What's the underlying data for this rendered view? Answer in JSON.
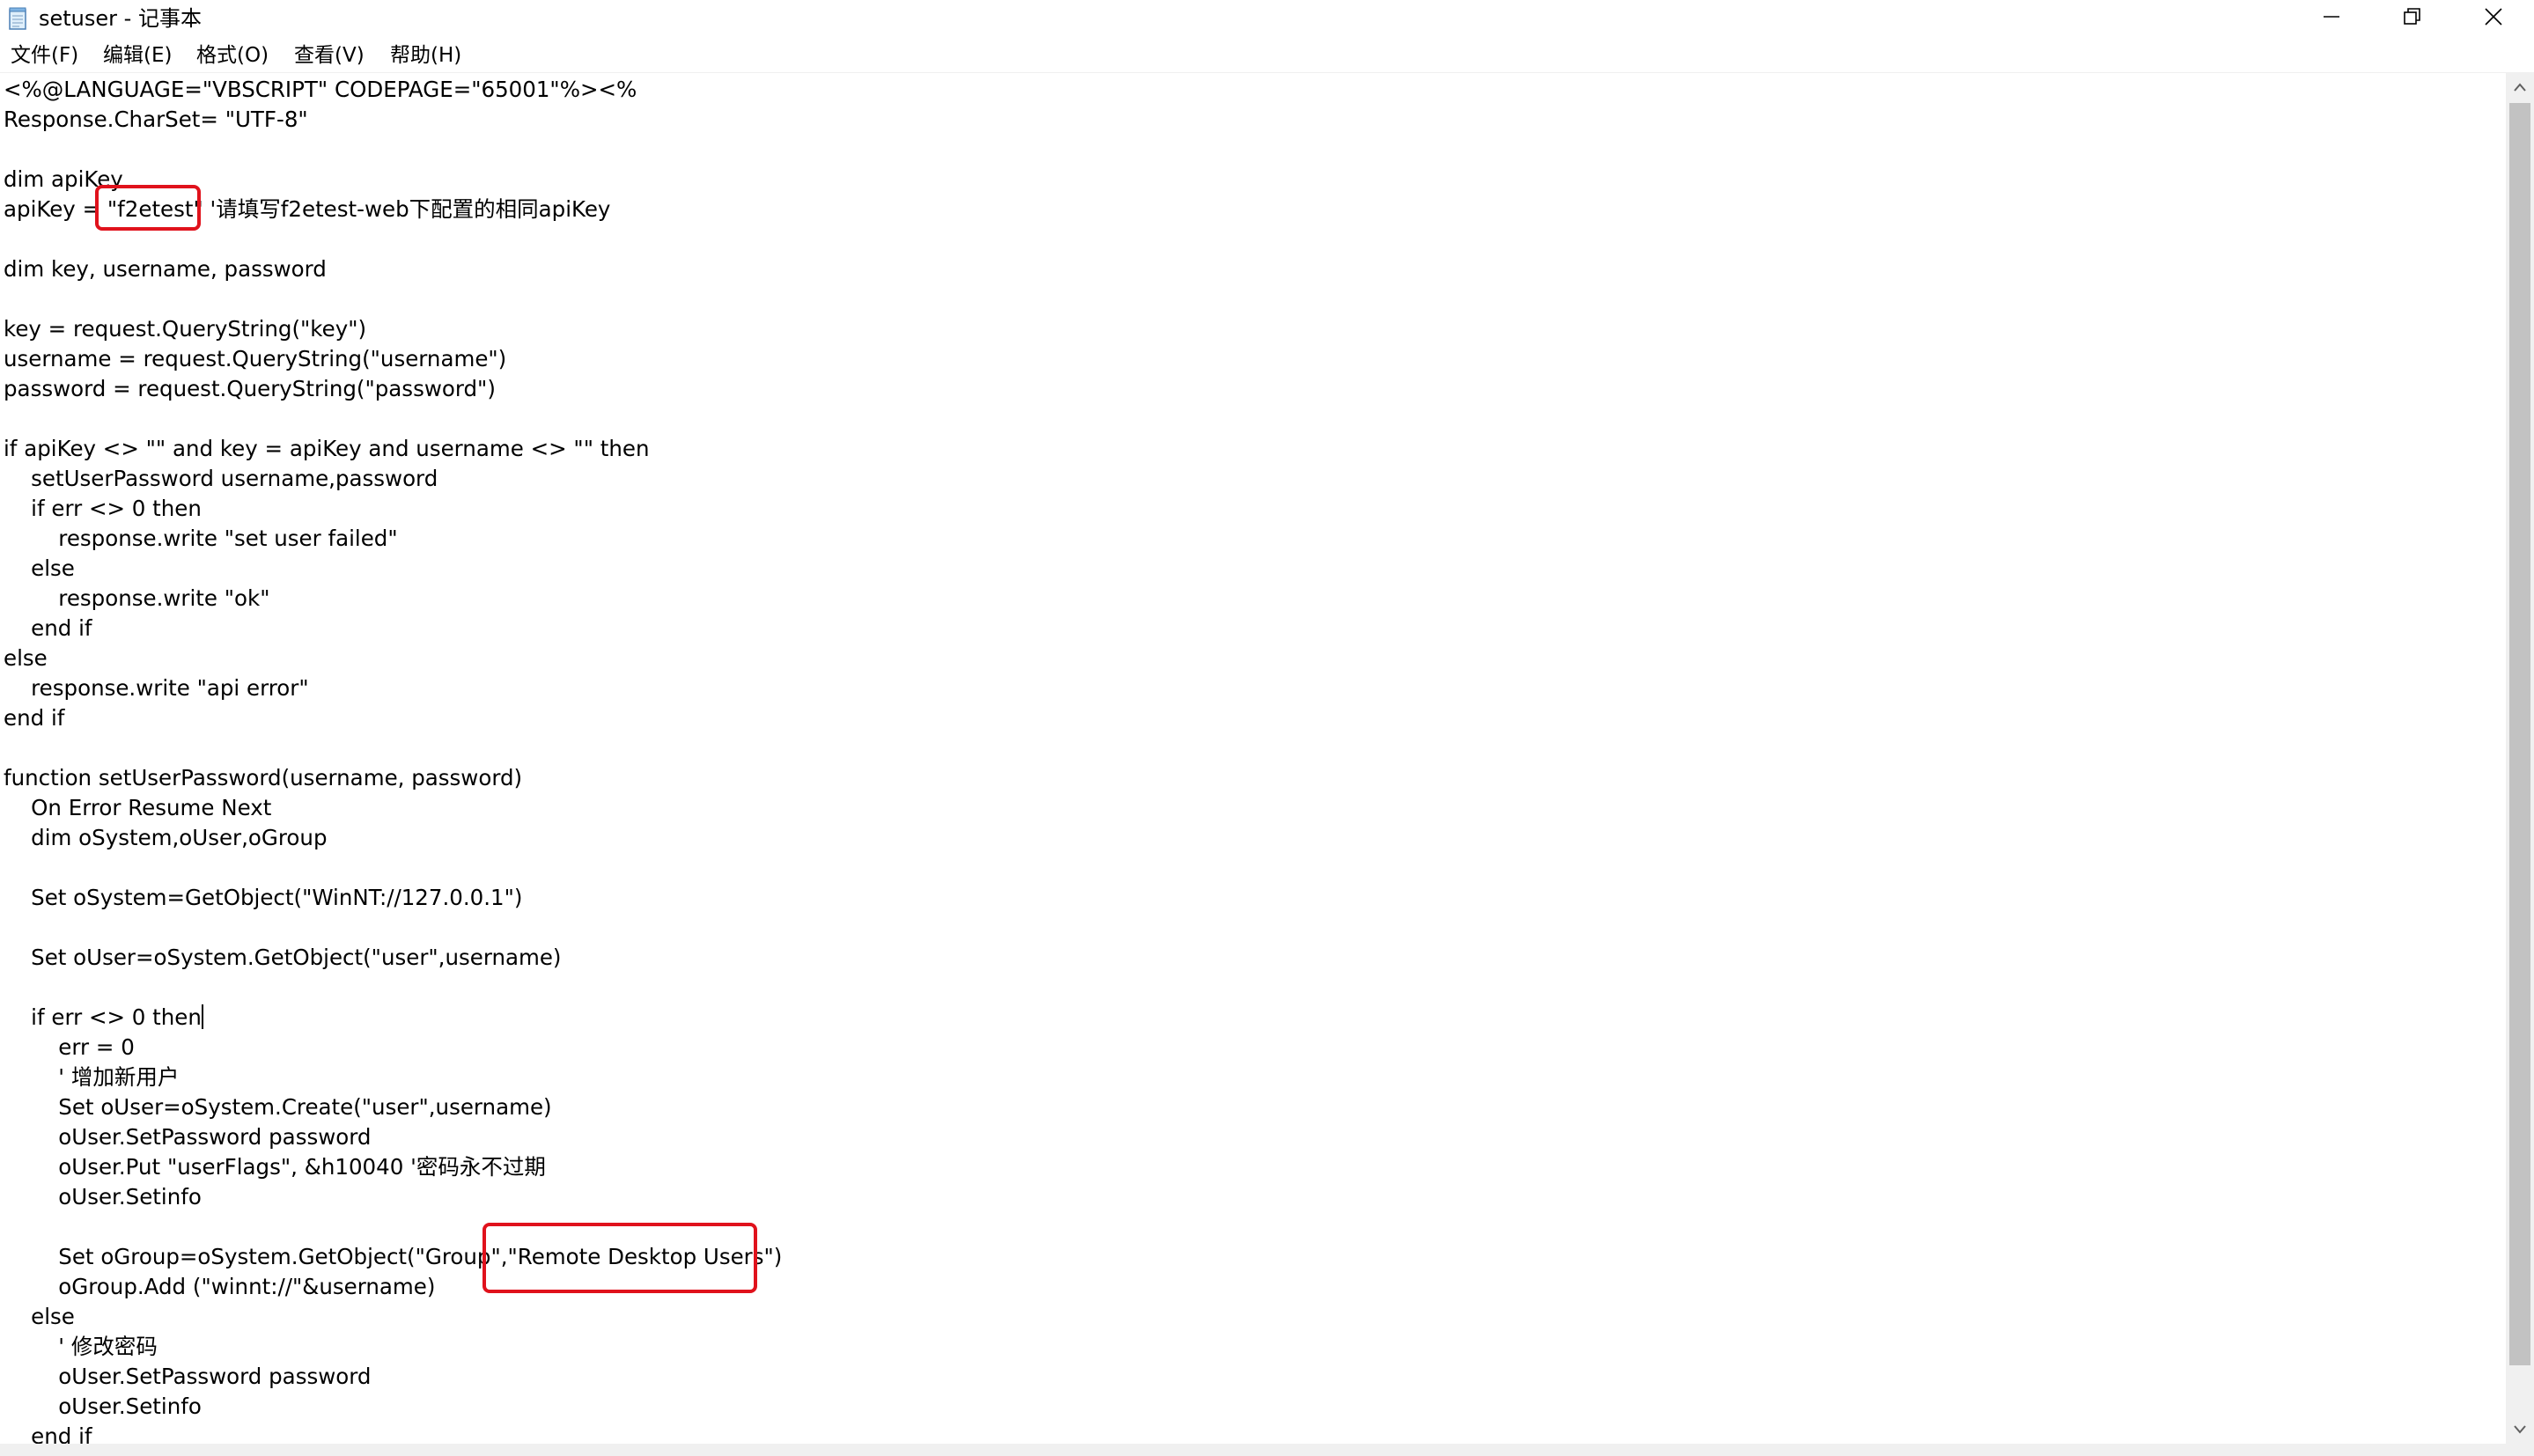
{
  "window": {
    "title": "setuser - 记事本",
    "minimize_glyph": "—",
    "maximize_glyph": "❐",
    "close_glyph": "✕"
  },
  "menu": [
    {
      "label": "文件(F)"
    },
    {
      "label": "编辑(E)"
    },
    {
      "label": "格式(O)"
    },
    {
      "label": "查看(V)"
    },
    {
      "label": "帮助(H)"
    }
  ],
  "editor": {
    "lines": [
      "<%@LANGUAGE=\"VBSCRIPT\" CODEPAGE=\"65001\"%><%",
      "Response.CharSet= \"UTF-8\"",
      "",
      "dim apiKey",
      "apiKey = \"f2etest\" '请填写f2etest-web下配置的相同apiKey",
      "",
      "dim key, username, password",
      "",
      "key = request.QueryString(\"key\")",
      "username = request.QueryString(\"username\")",
      "password = request.QueryString(\"password\")",
      "",
      "if apiKey <> \"\" and key = apiKey and username <> \"\" then",
      "    setUserPassword username,password",
      "    if err <> 0 then",
      "        response.write \"set user failed\"",
      "    else",
      "        response.write \"ok\"",
      "    end if",
      "else",
      "    response.write \"api error\"",
      "end if",
      "",
      "function setUserPassword(username, password)",
      "    On Error Resume Next",
      "    dim oSystem,oUser,oGroup",
      "",
      "    Set oSystem=GetObject(\"WinNT://127.0.0.1\")",
      "",
      "    Set oUser=oSystem.GetObject(\"user\",username)",
      "",
      "    if err <> 0 then",
      "        err = 0",
      "        ' 增加新用户",
      "        Set oUser=oSystem.Create(\"user\",username)",
      "        oUser.SetPassword password",
      "        oUser.Put \"userFlags\", &h10040 '密码永不过期",
      "        oUser.Setinfo",
      "",
      "        Set oGroup=oSystem.GetObject(\"Group\",\"Remote Desktop Users\")",
      "        oGroup.Add (\"winnt://\"&username)",
      "    else",
      "        ' 修改密码",
      "        oUser.SetPassword password",
      "        oUser.Setinfo",
      "    end if"
    ],
    "caret_line": 31,
    "highlighted": [
      {
        "text": "\"f2etest\"",
        "line": 4
      },
      {
        "text": "\"Remote Desktop Users\")",
        "line": 39
      }
    ]
  },
  "colors": {
    "highlight": "#e0121c",
    "text": "#000000",
    "background": "#ffffff",
    "scrollbar_track": "#f0f0f0",
    "scrollbar_thumb": "#c2c2c2"
  },
  "icons": [
    "notepad-icon",
    "minimize-icon",
    "maximize-icon",
    "close-icon",
    "scroll-up-arrow-icon",
    "scroll-down-arrow-icon"
  ]
}
